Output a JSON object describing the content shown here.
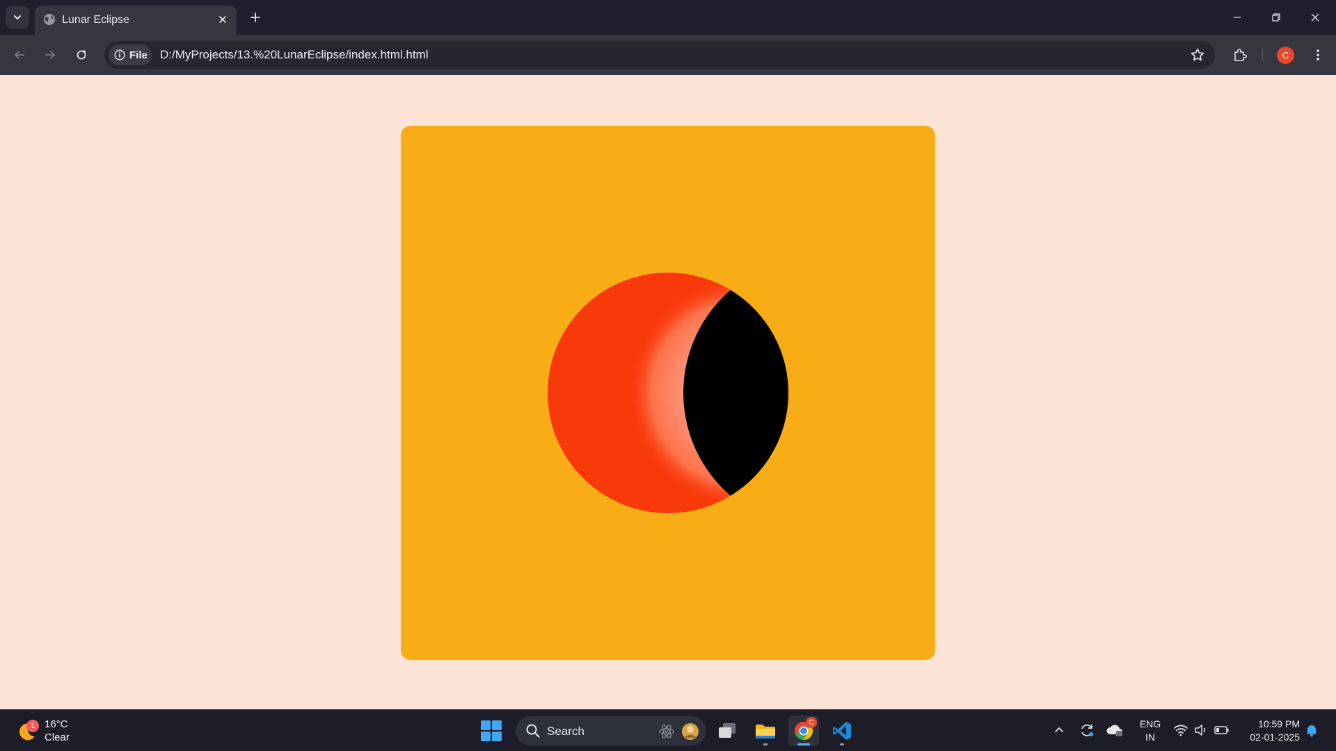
{
  "window": {
    "tab_title": "Lunar Eclipse",
    "tab_icon": "globe-icon"
  },
  "toolbar": {
    "site_chip_label": "File",
    "url": "D:/MyProjects/13.%20LunarEclipse/index.html.html",
    "profile_initial": "C"
  },
  "page": {
    "background_color": "#fde3d6",
    "card_color": "#f8ad17",
    "moon_color": "#f8390a",
    "moon_glow_color": "#ff6a45",
    "shadow_color": "#000000"
  },
  "taskbar": {
    "weather_temp": "16°C",
    "weather_condition": "Clear",
    "weather_badge": "1",
    "search_label": "Search",
    "chrome_badge": "C",
    "lang_line1": "ENG",
    "lang_line2": "IN",
    "time": "10:59 PM",
    "date": "02-01-2025"
  }
}
